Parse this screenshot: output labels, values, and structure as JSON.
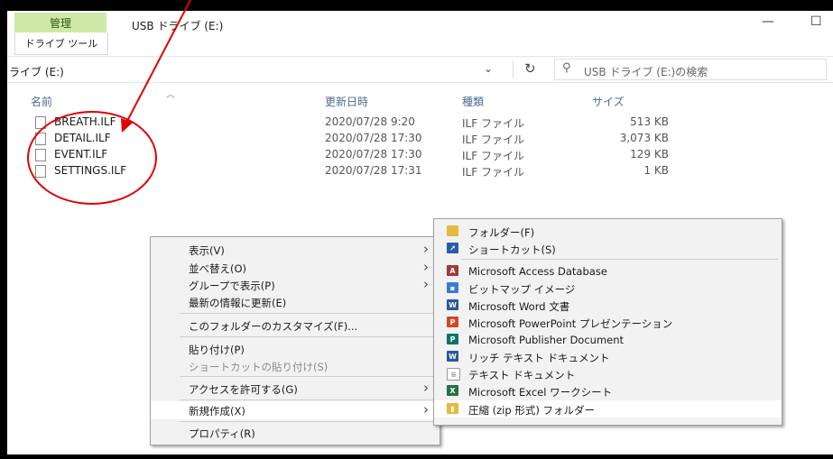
{
  "ribbon": {
    "manage_tab": "管理",
    "drive_tools_tab": "ドライブ ツール"
  },
  "window": {
    "title": "USB ドライブ (E:)",
    "minimize": "—",
    "maximize": "☐"
  },
  "address": {
    "path": "ライブ (E:)",
    "chevron": "⌄",
    "refresh": "↻",
    "search_placeholder": "USB ドライブ (E:)の検索",
    "search_icon": "⚲"
  },
  "columns": {
    "name": "名前",
    "modified": "更新日時",
    "type": "種類",
    "size": "サイズ"
  },
  "files": [
    {
      "name": "BREATH.ILF",
      "modified": "2020/07/28 9:20",
      "type": "ILF ファイル",
      "size": "513 KB"
    },
    {
      "name": "DETAIL.ILF",
      "modified": "2020/07/28 17:30",
      "type": "ILF ファイル",
      "size": "3,073 KB"
    },
    {
      "name": "EVENT.ILF",
      "modified": "2020/07/28 17:30",
      "type": "ILF ファイル",
      "size": "129 KB"
    },
    {
      "name": "SETTINGS.ILF",
      "modified": "2020/07/28 17:31",
      "type": "ILF ファイル",
      "size": "1 KB"
    }
  ],
  "context_menu": {
    "view": "表示(V)",
    "sort_by": "並べ替え(O)",
    "group_by": "グループで表示(P)",
    "refresh": "最新の情報に更新(E)",
    "customize": "このフォルダーのカスタマイズ(F)...",
    "paste": "貼り付け(P)",
    "paste_shortcut": "ショートカットの貼り付け(S)",
    "give_access": "アクセスを許可する(G)",
    "new": "新規作成(X)",
    "properties": "プロパティ(R)",
    "submenu_arrow": "›"
  },
  "new_submenu": [
    {
      "label": "フォルダー(F)",
      "icon": "folder-icon",
      "color": "#e8b93a"
    },
    {
      "label": "ショートカット(S)",
      "icon": "shortcut-icon",
      "color": "#2a5da8"
    },
    {
      "label": "Microsoft Access Database",
      "icon": "access-icon",
      "color": "#a4373a"
    },
    {
      "label": "ビットマップ イメージ",
      "icon": "bitmap-icon",
      "color": "#3a7bd5"
    },
    {
      "label": "Microsoft Word 文書",
      "icon": "word-icon",
      "color": "#2b579a"
    },
    {
      "label": "Microsoft PowerPoint プレゼンテーション",
      "icon": "powerpoint-icon",
      "color": "#d24726"
    },
    {
      "label": "Microsoft Publisher Document",
      "icon": "publisher-icon",
      "color": "#077568"
    },
    {
      "label": "リッチ テキスト ドキュメント",
      "icon": "rtf-icon",
      "color": "#2b579a"
    },
    {
      "label": "テキスト ドキュメント",
      "icon": "text-doc-icon",
      "color": "#9a9a9a"
    },
    {
      "label": "Microsoft Excel ワークシート",
      "icon": "excel-icon",
      "color": "#217346"
    },
    {
      "label": "圧縮 (zip 形式) フォルダー",
      "icon": "zip-folder-icon",
      "color": "#e8b93a"
    }
  ],
  "annotation_color": "#e00000"
}
